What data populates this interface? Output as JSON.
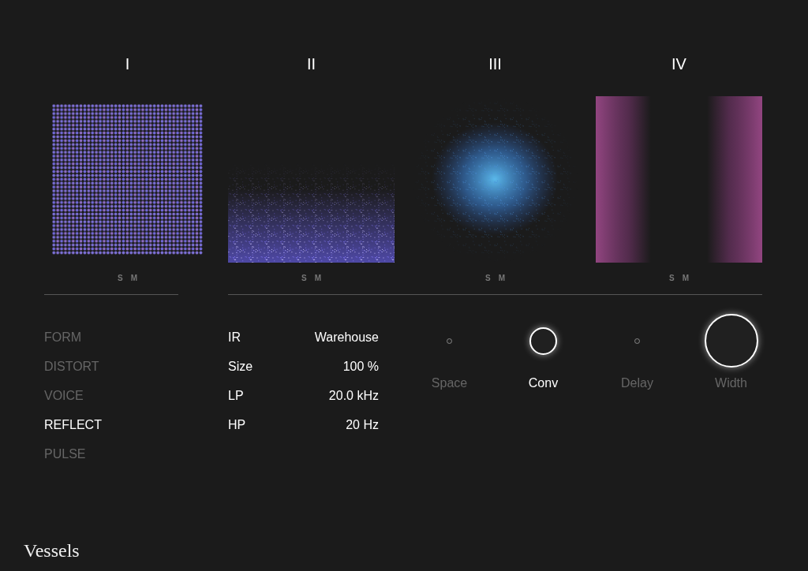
{
  "columns": [
    {
      "numeral": "I",
      "kind": "grid",
      "buttons": [
        "S",
        "M"
      ]
    },
    {
      "numeral": "II",
      "kind": "floor",
      "buttons": [
        "S",
        "M"
      ]
    },
    {
      "numeral": "III",
      "kind": "cloud",
      "buttons": [
        "S",
        "M"
      ]
    },
    {
      "numeral": "IV",
      "kind": "sides",
      "buttons": [
        "S",
        "M"
      ]
    }
  ],
  "nav": [
    {
      "label": "FORM",
      "selected": false
    },
    {
      "label": "DISTORT",
      "selected": false
    },
    {
      "label": "VOICE",
      "selected": false
    },
    {
      "label": "REFLECT",
      "selected": true
    },
    {
      "label": "PULSE",
      "selected": false
    }
  ],
  "params": [
    {
      "name": "IR",
      "value": "Warehouse"
    },
    {
      "name": "Size",
      "value": "100 %"
    },
    {
      "name": "LP",
      "value": "20.0 kHz"
    },
    {
      "name": "HP",
      "value": "20 Hz"
    }
  ],
  "knobs": [
    {
      "label": "Space",
      "kind": "dot",
      "selected": false
    },
    {
      "label": "Conv",
      "kind": "ring",
      "selected": true
    },
    {
      "label": "Delay",
      "kind": "dot",
      "selected": false
    },
    {
      "label": "Width",
      "kind": "wide-ring",
      "selected": false
    }
  ],
  "brand": "Vessels"
}
